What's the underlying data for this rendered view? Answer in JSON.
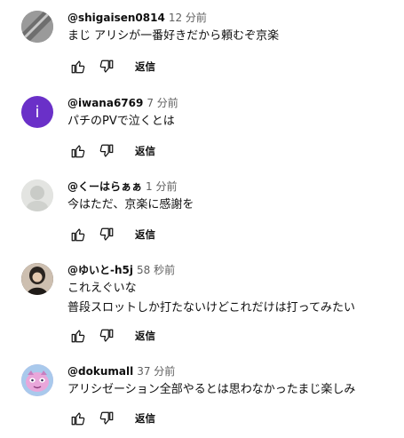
{
  "comments": [
    {
      "handle": "@shigaisen0814",
      "time": "12 分前",
      "lines": [
        "まじ アリシが一番好きだから頼むぞ京楽"
      ],
      "avatar_letter": "",
      "avatar_color": "#8a8a8a"
    },
    {
      "handle": "@iwana6769",
      "time": "7 分前",
      "lines": [
        "パチのPVで泣くとは"
      ],
      "avatar_letter": "i",
      "avatar_color": "#6a30c8"
    },
    {
      "handle": "@くーはらぁぁ",
      "time": "1 分前",
      "lines": [
        "今はただ、京楽に感謝を"
      ],
      "avatar_letter": "",
      "avatar_color": "#d9dbd8"
    },
    {
      "handle": "@ゆいと-h5j",
      "time": "58 秒前",
      "lines": [
        "これえぐいな",
        "普段スロットしか打たないけどこれだけは打ってみたい"
      ],
      "avatar_letter": "",
      "avatar_color": "#3b3530"
    },
    {
      "handle": "@dokumall",
      "time": "37 分前",
      "lines": [
        "アリシゼーション全部やるとは思わなかったまじ楽しみ"
      ],
      "avatar_letter": "",
      "avatar_color": "#e7b3dd"
    }
  ],
  "reply_label": "返信",
  "icons": {
    "like": "thumb-up-icon",
    "dislike": "thumb-down-icon"
  }
}
